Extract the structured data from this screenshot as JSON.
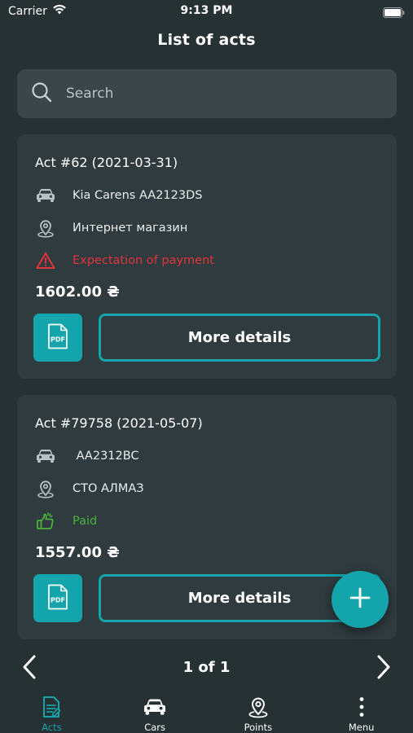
{
  "status_bar": {
    "carrier": "Carrier",
    "time": "9:13 PM"
  },
  "header": {
    "title": "List of acts"
  },
  "search": {
    "placeholder": "Search",
    "value": ""
  },
  "acts": [
    {
      "title": "Act #62 (2021-03-31)",
      "car": "Kia Carens AA2123DS",
      "point": "Интернет магазин",
      "status": "Expectation of payment",
      "status_type": "warning",
      "amount": "1602.00 ₴",
      "pdf_label": "PDF",
      "details_label": "More details"
    },
    {
      "title": "Act #79758 (2021-05-07)",
      "car": " AA2312BC",
      "point": "СТО АЛМАЗ",
      "status": "Paid",
      "status_type": "paid",
      "amount": "1557.00 ₴",
      "pdf_label": "PDF",
      "details_label": "More details"
    }
  ],
  "pagination": {
    "label": "1 of 1"
  },
  "tabs": [
    {
      "label": "Acts",
      "icon": "document-icon",
      "active": true
    },
    {
      "label": "Cars",
      "icon": "car-icon",
      "active": false
    },
    {
      "label": "Points",
      "icon": "location-pin-icon",
      "active": false
    },
    {
      "label": "Menu",
      "icon": "more-vertical-icon",
      "active": false
    }
  ],
  "colors": {
    "background": "#263133",
    "card": "#2f3b3e",
    "search": "#3b4649",
    "accent": "#14a4ac",
    "warning": "#e0343c",
    "paid": "#4cb03f"
  }
}
